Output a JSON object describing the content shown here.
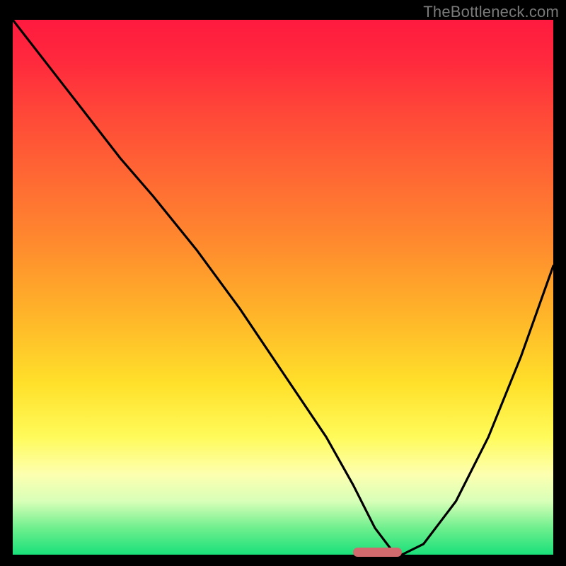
{
  "watermark": "TheBottleneck.com",
  "chart_data": {
    "type": "line",
    "title": "",
    "xlabel": "",
    "ylabel": "",
    "xlim": [
      0,
      100
    ],
    "ylim": [
      0,
      100
    ],
    "x": [
      0,
      10,
      20,
      26,
      34,
      42,
      50,
      58,
      63,
      67,
      70,
      72,
      76,
      82,
      88,
      94,
      100
    ],
    "y": [
      100,
      87,
      74,
      67,
      57,
      46,
      34,
      22,
      13,
      5,
      1,
      0,
      2,
      10,
      22,
      37,
      54
    ],
    "highlight_x_range": [
      63,
      72
    ],
    "gradient_stops": [
      {
        "pos": 0.0,
        "color": "#ff1a3f"
      },
      {
        "pos": 0.3,
        "color": "#ff6a33"
      },
      {
        "pos": 0.55,
        "color": "#ffb429"
      },
      {
        "pos": 0.78,
        "color": "#fffb5a"
      },
      {
        "pos": 0.9,
        "color": "#d8ffb8"
      },
      {
        "pos": 1.0,
        "color": "#19e07a"
      }
    ]
  }
}
